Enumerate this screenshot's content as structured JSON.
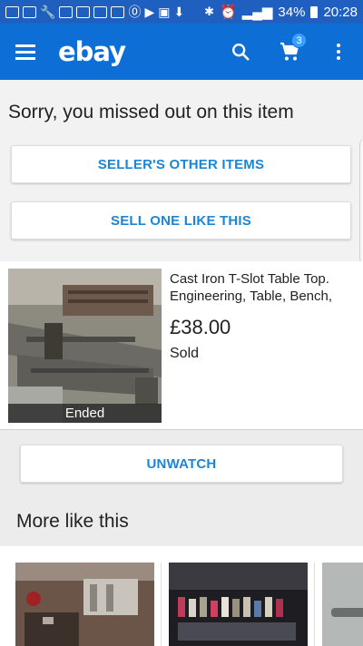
{
  "status_bar": {
    "battery": "34%",
    "time": "20:28"
  },
  "app_bar": {
    "logo": "ebay",
    "cart_count": "3",
    "icons": [
      "menu-icon",
      "search-icon",
      "cart-icon",
      "more-vert-icon"
    ],
    "color": "#0d6fd6"
  },
  "missed": {
    "title": "Sorry, you missed out on this item",
    "seller_button": "SELLER'S OTHER ITEMS",
    "sell_button": "SELL ONE LIKE THIS"
  },
  "item": {
    "title": "Cast Iron T-Slot Table Top. Engineering, Table, Bench,",
    "price": "£38.00",
    "status": "Sold",
    "badge": "Ended"
  },
  "actions": {
    "unwatch": "UNWATCH"
  },
  "more_like_this": {
    "title": "More like this"
  },
  "colors": {
    "accent": "#1a86d9",
    "badge": "#3aa0ff"
  }
}
